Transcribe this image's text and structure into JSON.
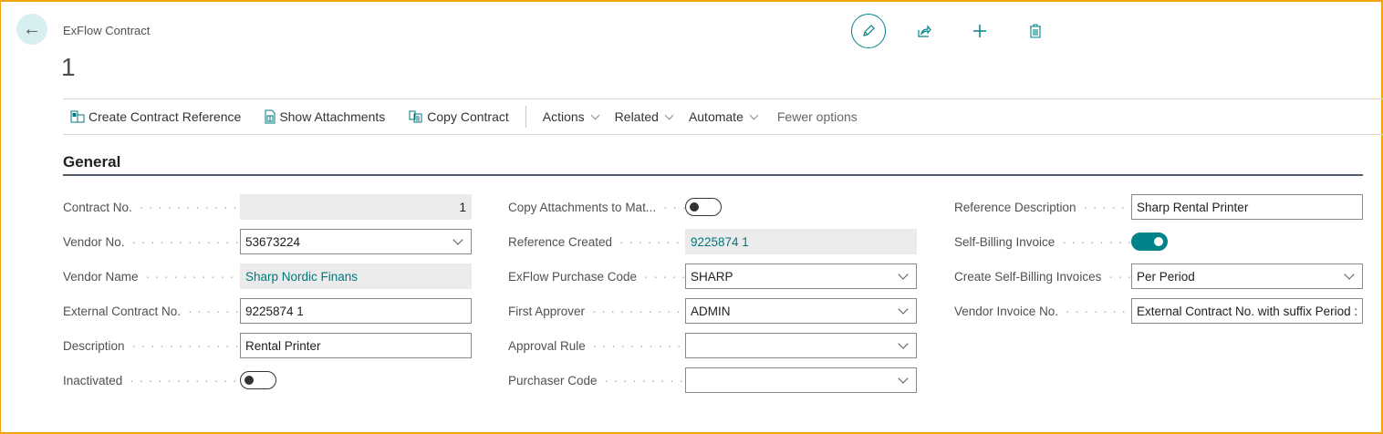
{
  "header": {
    "breadcrumb": "ExFlow Contract",
    "title": "1"
  },
  "actions": {
    "create_ref": "Create Contract Reference",
    "show_attach": "Show Attachments",
    "copy": "Copy Contract",
    "menus": [
      "Actions",
      "Related",
      "Automate"
    ],
    "fewer": "Fewer options"
  },
  "section": "General",
  "col1": [
    {
      "label": "Contract No.",
      "value": "1",
      "type": "readonly"
    },
    {
      "label": "Vendor No.",
      "value": "53673224",
      "type": "dropdown"
    },
    {
      "label": "Vendor Name",
      "value": "Sharp Nordic Finans",
      "type": "readonly-link"
    },
    {
      "label": "External Contract No.",
      "value": "9225874 1",
      "type": "text"
    },
    {
      "label": "Description",
      "value": "Rental Printer",
      "type": "text"
    },
    {
      "label": "Inactivated",
      "value": false,
      "type": "toggle"
    }
  ],
  "col2": [
    {
      "label": "Copy Attachments to Mat...",
      "value": false,
      "type": "toggle"
    },
    {
      "label": "Reference Created",
      "value": "9225874 1",
      "type": "readonly-link"
    },
    {
      "label": "ExFlow Purchase Code",
      "value": "SHARP",
      "type": "dropdown"
    },
    {
      "label": "First Approver",
      "value": "ADMIN",
      "type": "dropdown"
    },
    {
      "label": "Approval Rule",
      "value": "",
      "type": "dropdown"
    },
    {
      "label": "Purchaser Code",
      "value": "",
      "type": "dropdown"
    }
  ],
  "col3": [
    {
      "label": "Reference Description",
      "value": "Sharp Rental Printer",
      "type": "text"
    },
    {
      "label": "Self-Billing Invoice",
      "value": true,
      "type": "toggle"
    },
    {
      "label": "Create Self-Billing Invoices",
      "value": "Per Period",
      "type": "dropdown"
    },
    {
      "label": "Vendor Invoice No.",
      "value": "External Contract No. with suffix Period :",
      "type": "text"
    }
  ],
  "colors": {
    "accent": "#008489",
    "frame": "#f0a30a"
  }
}
